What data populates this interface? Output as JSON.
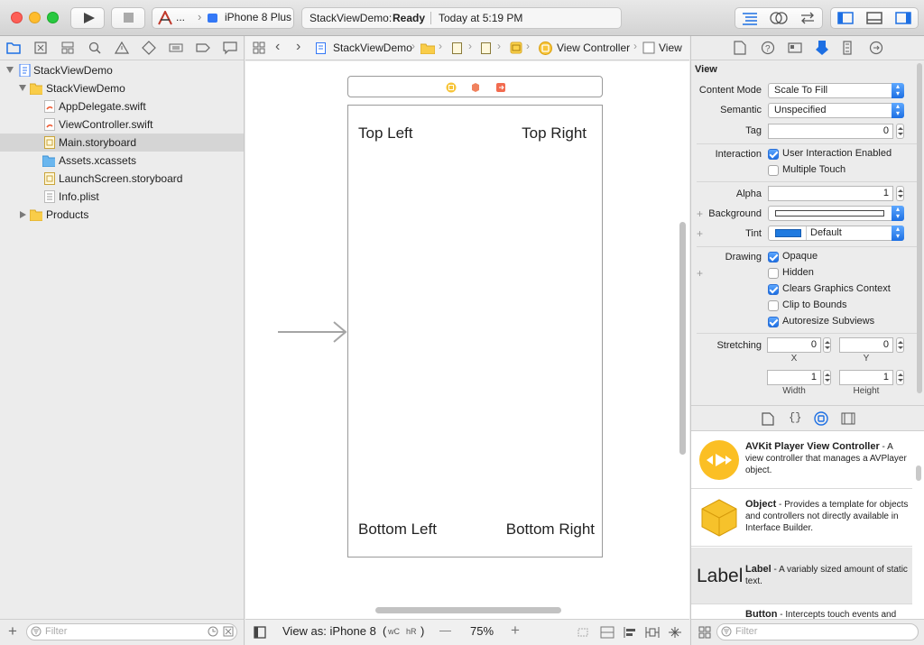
{
  "toolbar": {
    "scheme_name": "...",
    "device": "iPhone 8 Plus",
    "activity_project": "StackViewDemo:",
    "activity_status": "Ready",
    "activity_time": "Today at 5:19 PM"
  },
  "navigator": {
    "items": [
      {
        "label": "StackViewDemo",
        "kind": "project"
      },
      {
        "label": "StackViewDemo",
        "kind": "folder"
      },
      {
        "label": "AppDelegate.swift",
        "kind": "swift"
      },
      {
        "label": "ViewController.swift",
        "kind": "swift"
      },
      {
        "label": "Main.storyboard",
        "kind": "storyboard",
        "selected": true
      },
      {
        "label": "Assets.xcassets",
        "kind": "assets"
      },
      {
        "label": "LaunchScreen.storyboard",
        "kind": "storyboard"
      },
      {
        "label": "Info.plist",
        "kind": "plist"
      },
      {
        "label": "Products",
        "kind": "folder"
      }
    ],
    "filter_placeholder": "Filter"
  },
  "jumpbar": {
    "project": "StackViewDemo",
    "view_controller": "View Controller",
    "view": "View"
  },
  "canvas": {
    "top_left": "Top Left",
    "top_right": "Top Right",
    "bottom_left": "Bottom Left",
    "bottom_right": "Bottom Right"
  },
  "editor_bottom": {
    "view_as_label": "View as: iPhone 8",
    "size_class_w": "wC",
    "size_class_h": "hR",
    "size_class_suffix": ")",
    "size_class_prefix": "(",
    "zoom": "75%",
    "minus": "—",
    "plus": "+"
  },
  "inspector": {
    "section_title": "View",
    "content_mode_label": "Content Mode",
    "content_mode_value": "Scale To Fill",
    "semantic_label": "Semantic",
    "semantic_value": "Unspecified",
    "tag_label": "Tag",
    "tag_value": "0",
    "interaction_label": "Interaction",
    "user_interaction": "User Interaction Enabled",
    "multiple_touch": "Multiple Touch",
    "alpha_label": "Alpha",
    "alpha_value": "1",
    "background_label": "Background",
    "tint_label": "Tint",
    "tint_value": "Default",
    "drawing_label": "Drawing",
    "opaque": "Opaque",
    "hidden": "Hidden",
    "clears_graphics": "Clears Graphics Context",
    "clip_bounds": "Clip to Bounds",
    "autoresize": "Autoresize Subviews",
    "stretching_label": "Stretching",
    "stretch_x": "0",
    "stretch_y": "0",
    "stretch_w": "1",
    "stretch_h": "1",
    "x_label": "X",
    "y_label": "Y",
    "width_label": "Width",
    "height_label": "Height",
    "checkbox_states": {
      "user_interaction": true,
      "multiple_touch": false,
      "opaque": true,
      "hidden": false,
      "clears_graphics": true,
      "clip_bounds": false,
      "autoresize": true
    },
    "tint_color": "#1f7ae0"
  },
  "library": {
    "items": [
      {
        "title": "AVKit Player View Controller",
        "desc": " - A view controller that manages a AVPlayer object."
      },
      {
        "title": "Object",
        "desc": " - Provides a template for objects and controllers not directly available in Interface Builder."
      },
      {
        "title": "Label",
        "desc": " - A variably sized amount of static text.",
        "preview": "Label"
      },
      {
        "title": "Button",
        "desc": " - Intercepts touch events and"
      }
    ],
    "filter_placeholder": "Filter"
  },
  "colors": {
    "accent": "#1d6fe3",
    "selection": "#d5d5d5"
  }
}
